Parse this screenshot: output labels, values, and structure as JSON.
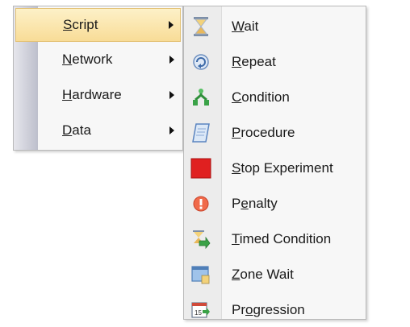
{
  "main_menu": {
    "items": [
      {
        "label": "Script",
        "accel": "S",
        "has_submenu": true,
        "selected": true
      },
      {
        "label": "Network",
        "accel": "N",
        "has_submenu": true,
        "selected": false
      },
      {
        "label": "Hardware",
        "accel": "H",
        "has_submenu": true,
        "selected": false
      },
      {
        "label": "Data",
        "accel": "D",
        "has_submenu": true,
        "selected": false
      }
    ]
  },
  "sub_menu": {
    "items": [
      {
        "label": "Wait",
        "accel_index": 0,
        "icon": "hourglass-icon"
      },
      {
        "label": "Repeat",
        "accel_index": 0,
        "icon": "repeat-icon"
      },
      {
        "label": "Condition",
        "accel_index": 0,
        "icon": "condition-icon"
      },
      {
        "label": "Procedure",
        "accel_index": 0,
        "icon": "procedure-icon"
      },
      {
        "label": "Stop Experiment",
        "accel_index": 0,
        "icon": "stop-icon"
      },
      {
        "label": "Penalty",
        "accel_index": 1,
        "icon": "penalty-icon"
      },
      {
        "label": "Timed Condition",
        "accel_index": 0,
        "icon": "timed-condition-icon"
      },
      {
        "label": "Zone Wait",
        "accel_index": 0,
        "icon": "zone-wait-icon"
      },
      {
        "label": "Progression",
        "accel_index": 2,
        "icon": "progression-icon"
      }
    ]
  },
  "colors": {
    "selection_top": "#fdf1c8",
    "selection_bottom": "#f8dc97",
    "stop_red": "#e02020"
  }
}
